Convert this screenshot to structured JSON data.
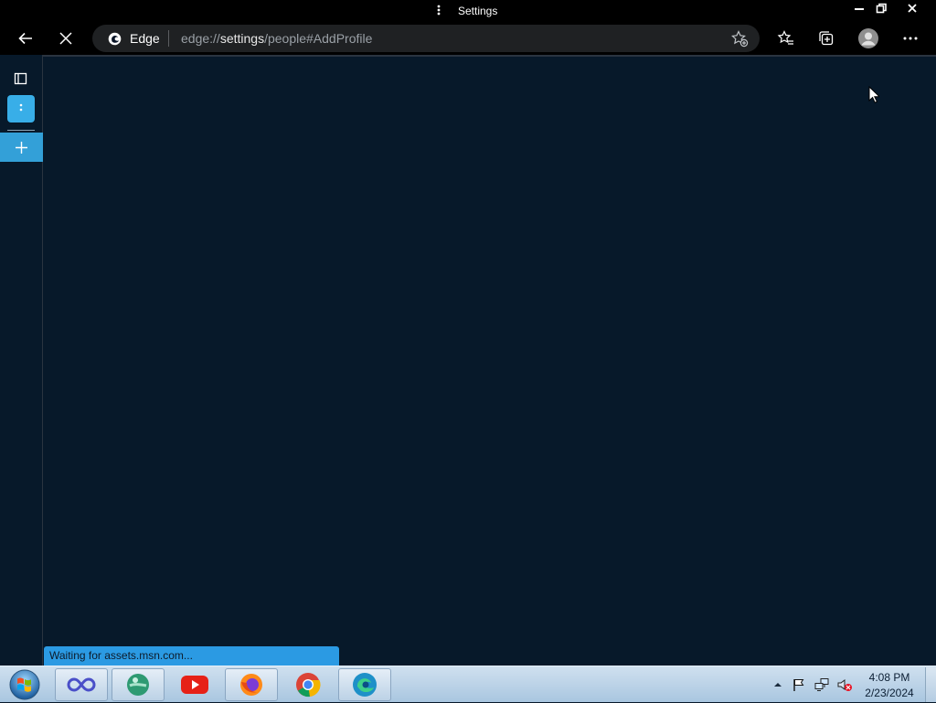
{
  "window": {
    "title": "Settings",
    "menu_icon": "kebab-dots-icon",
    "controls": [
      "minimize-icon",
      "restore-icon",
      "close-icon"
    ]
  },
  "toolbar": {
    "back_icon": "arrow-left-icon",
    "stop_icon": "close-x-icon",
    "address": {
      "site_label": "Edge",
      "url_scheme": "edge://",
      "url_host": "settings",
      "url_path": "/people#AddProfile",
      "favorite_add_icon": "star-plus-icon"
    },
    "favorites_icon": "favorites-star-list-icon",
    "collections_icon": "collections-icon",
    "profile_icon": "avatar-icon",
    "more_icon": "ellipsis-icon"
  },
  "sidebar": {
    "toggle_icon": "vertical-tabs-icon",
    "active_tab_icon": "kebab-dots-icon",
    "new_tab_icon": "plus-icon"
  },
  "status": {
    "text": "Waiting for assets.msn.com..."
  },
  "taskbar": {
    "start_icon": "windows-orb-icon",
    "apps": [
      {
        "name": "infinity-app",
        "icon": "infinity-icon",
        "active": true
      },
      {
        "name": "green-circle-app",
        "icon": "green-circle-icon",
        "active": true
      },
      {
        "name": "youtube",
        "icon": "youtube-icon",
        "active": false
      },
      {
        "name": "firefox",
        "icon": "firefox-icon",
        "active": true
      },
      {
        "name": "chrome",
        "icon": "chrome-icon",
        "active": false
      },
      {
        "name": "edge",
        "icon": "edge-icon",
        "active": true
      }
    ],
    "tray": {
      "icons": [
        "chevron-up-icon",
        "flag-icon",
        "network-icon",
        "volume-muted-icon"
      ],
      "time": "4:08 PM",
      "date": "2/23/2024"
    }
  },
  "colors": {
    "page_bg": "#07192a",
    "chrome_bg": "#000000",
    "accent": "#38aee8",
    "status_bg": "#2b9ae3"
  }
}
